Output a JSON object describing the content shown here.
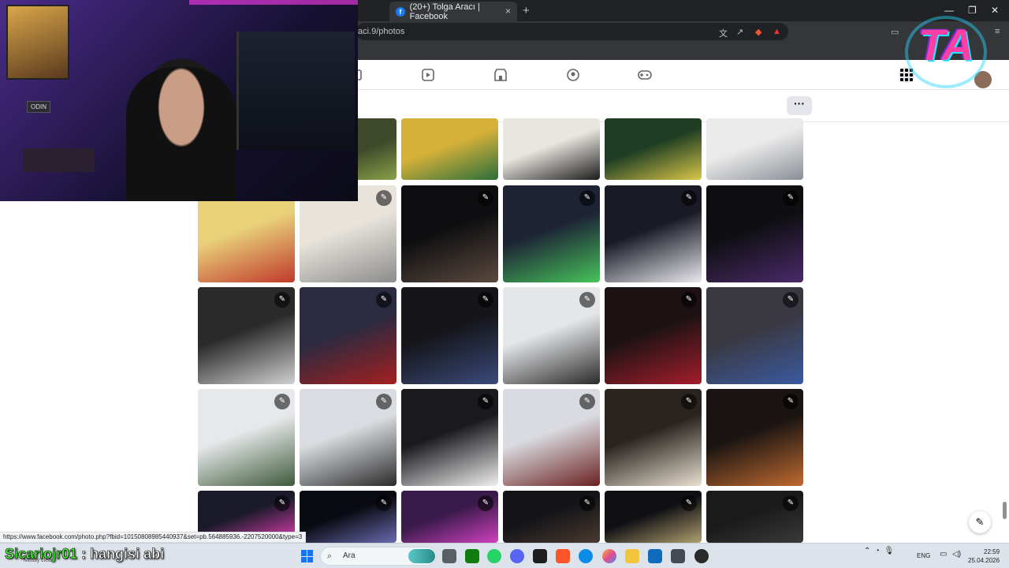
{
  "browser": {
    "tab_title": "(20+) Tolga Aracı | Facebook",
    "tab_close": "×",
    "new_tab": "+",
    "url": "aci.9/photos",
    "win_minimize": "—",
    "win_restore": "❐",
    "win_close": "✕"
  },
  "facebook": {
    "more_label": "···",
    "fb_logo": "f"
  },
  "photos": [
    {
      "row": 0,
      "col": 0,
      "tone": "#3f4a2a",
      "tone2": "#8aa14a",
      "edit": false
    },
    {
      "row": 0,
      "col": 1,
      "tone": "#d6b13a",
      "tone2": "#2b6e3a",
      "edit": false
    },
    {
      "row": 0,
      "col": 2,
      "tone": "#e9e6e0",
      "tone2": "#1c1c1c",
      "edit": false
    },
    {
      "row": 0,
      "col": 3,
      "tone": "#1e3d22",
      "tone2": "#d9c64a",
      "edit": false
    },
    {
      "row": 0,
      "col": 4,
      "tone": "#eaeaea",
      "tone2": "#8a8f96",
      "edit": false
    },
    {
      "row": 1,
      "col": 0,
      "tone": "#e9d17a",
      "tone2": "#c0392b",
      "edit": false
    },
    {
      "row": 1,
      "col": 1,
      "tone": "#e8e4dc",
      "tone2": "#8c8c8c",
      "edit": true
    },
    {
      "row": 1,
      "col": 2,
      "tone": "#0e0e10",
      "tone2": "#5a4a40",
      "edit": true
    },
    {
      "row": 1,
      "col": 3,
      "tone": "#1d2235",
      "tone2": "#46c35a",
      "edit": true
    },
    {
      "row": 1,
      "col": 4,
      "tone": "#1a1a26",
      "tone2": "#e9e9ee",
      "edit": true
    },
    {
      "row": 1,
      "col": 5,
      "tone": "#0f0f12",
      "tone2": "#4a2a6a",
      "edit": true
    },
    {
      "row": 2,
      "col": 0,
      "tone": "#2a2a2a",
      "tone2": "#d0d0d0",
      "edit": true
    },
    {
      "row": 2,
      "col": 1,
      "tone": "#2a2a40",
      "tone2": "#a32020",
      "edit": true
    },
    {
      "row": 2,
      "col": 2,
      "tone": "#15151a",
      "tone2": "#3a4a7a",
      "edit": true
    },
    {
      "row": 2,
      "col": 3,
      "tone": "#e4e6e8",
      "tone2": "#2a2a2a",
      "edit": true
    },
    {
      "row": 2,
      "col": 4,
      "tone": "#1c1214",
      "tone2": "#a31e2a",
      "edit": true
    },
    {
      "row": 2,
      "col": 5,
      "tone": "#3a3840",
      "tone2": "#3a5aa0",
      "edit": true
    },
    {
      "row": 3,
      "col": 0,
      "tone": "#e6e8ea",
      "tone2": "#3e5a3a",
      "edit": true
    },
    {
      "row": 3,
      "col": 1,
      "tone": "#d9dce0",
      "tone2": "#2a2a2a",
      "edit": true
    },
    {
      "row": 3,
      "col": 2,
      "tone": "#1a1a1e",
      "tone2": "#f0f0f0",
      "edit": true
    },
    {
      "row": 3,
      "col": 3,
      "tone": "#d9dbe0",
      "tone2": "#6a2020",
      "edit": true
    },
    {
      "row": 3,
      "col": 4,
      "tone": "#2a2420",
      "tone2": "#e8e0d0",
      "edit": true
    },
    {
      "row": 3,
      "col": 5,
      "tone": "#1a1412",
      "tone2": "#c06a30",
      "edit": true
    },
    {
      "row": 4,
      "col": 0,
      "tone": "#1a1a2a",
      "tone2": "#e63fb5",
      "edit": true
    },
    {
      "row": 4,
      "col": 1,
      "tone": "#0a0a12",
      "tone2": "#6a6ab0",
      "edit": true
    },
    {
      "row": 4,
      "col": 2,
      "tone": "#3a1a4a",
      "tone2": "#d040c0",
      "edit": true
    },
    {
      "row": 4,
      "col": 3,
      "tone": "#141418",
      "tone2": "#4a3a30",
      "edit": true
    },
    {
      "row": 4,
      "col": 4,
      "tone": "#101014",
      "tone2": "#b0a070",
      "edit": true
    },
    {
      "row": 4,
      "col": 5,
      "tone": "#1a1a1a",
      "tone2": "#3a3a3a",
      "edit": true
    }
  ],
  "overlay": {
    "odin_label": "ODIN",
    "logo_text": "TA"
  },
  "status_url": "https://www.facebook.com/photo.php?fbid=10150808985440937&set=pb.564885936.-2207520000&type=3",
  "chat": {
    "username": "Sicariojr01",
    "message": " : hangisi abi"
  },
  "taskbar": {
    "weather": "Mostly clear",
    "search_placeholder": "Ara",
    "language": "ENG",
    "time": "22:59",
    "date": "25.04.2026"
  },
  "colors": {
    "chrome_bg": "#202124",
    "fb_blue": "#1877f2",
    "chat_user": "#4cff39"
  }
}
